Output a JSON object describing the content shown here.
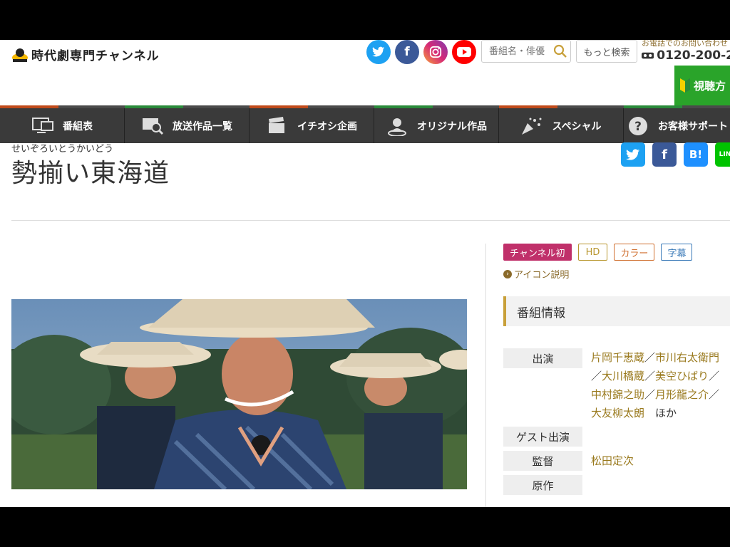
{
  "header": {
    "logo_text": "時代劇専門チャンネル",
    "search_placeholder": "番組名・俳優",
    "more_search": "もっと検索",
    "phone_label": "お電話でのお問い合わせ",
    "phone_number": "0120-200-2",
    "watch_label": "視聴方",
    "social": [
      {
        "name": "twitter",
        "glyph": "t",
        "color": "#1da1f2"
      },
      {
        "name": "facebook",
        "glyph": "f",
        "color": "#3b5998"
      },
      {
        "name": "instagram",
        "glyph": "◎",
        "color": "#c13584"
      },
      {
        "name": "youtube",
        "glyph": "▶",
        "color": "#ff0000"
      }
    ]
  },
  "nav": [
    {
      "label": "番組表",
      "icon": "monitor-icon",
      "accent": "#c04a1a"
    },
    {
      "label": "放送作品一覧",
      "icon": "search-screen-icon",
      "accent": "#2a8a3a"
    },
    {
      "label": "イチオシ企画",
      "icon": "clapperboard-icon",
      "accent": "#c04a1a"
    },
    {
      "label": "オリジナル作品",
      "icon": "person-icon",
      "accent": "#2a8a3a"
    },
    {
      "label": "スペシャル",
      "icon": "cracker-icon",
      "accent": "#c04a1a"
    },
    {
      "label": "お客様サポート",
      "icon": "question-icon",
      "accent": "#2a8a3a"
    }
  ],
  "program": {
    "ruby": "せいぞろいとうかいどう",
    "title": "勢揃い東海道"
  },
  "badges": [
    {
      "label": "チャンネル初",
      "color": "#c0306a",
      "filled": true
    },
    {
      "label": "HD",
      "color": "#b8962e",
      "filled": false
    },
    {
      "label": "カラー",
      "color": "#d07030",
      "filled": false
    },
    {
      "label": "字幕",
      "color": "#3a7ab8",
      "filled": false
    }
  ],
  "icon_explain": "アイコン説明",
  "section_title": "番組情報",
  "info": {
    "cast_label": "出演",
    "cast": [
      "片岡千恵蔵",
      "市川右太衛門",
      "大川橋蔵",
      "美空ひばり",
      "中村錦之助",
      "月形龍之介",
      "大友柳太朗"
    ],
    "cast_suffix": "ほか",
    "guest_label": "ゲスト出演",
    "director_label": "監督",
    "director": "松田定次",
    "original_label": "原作"
  }
}
